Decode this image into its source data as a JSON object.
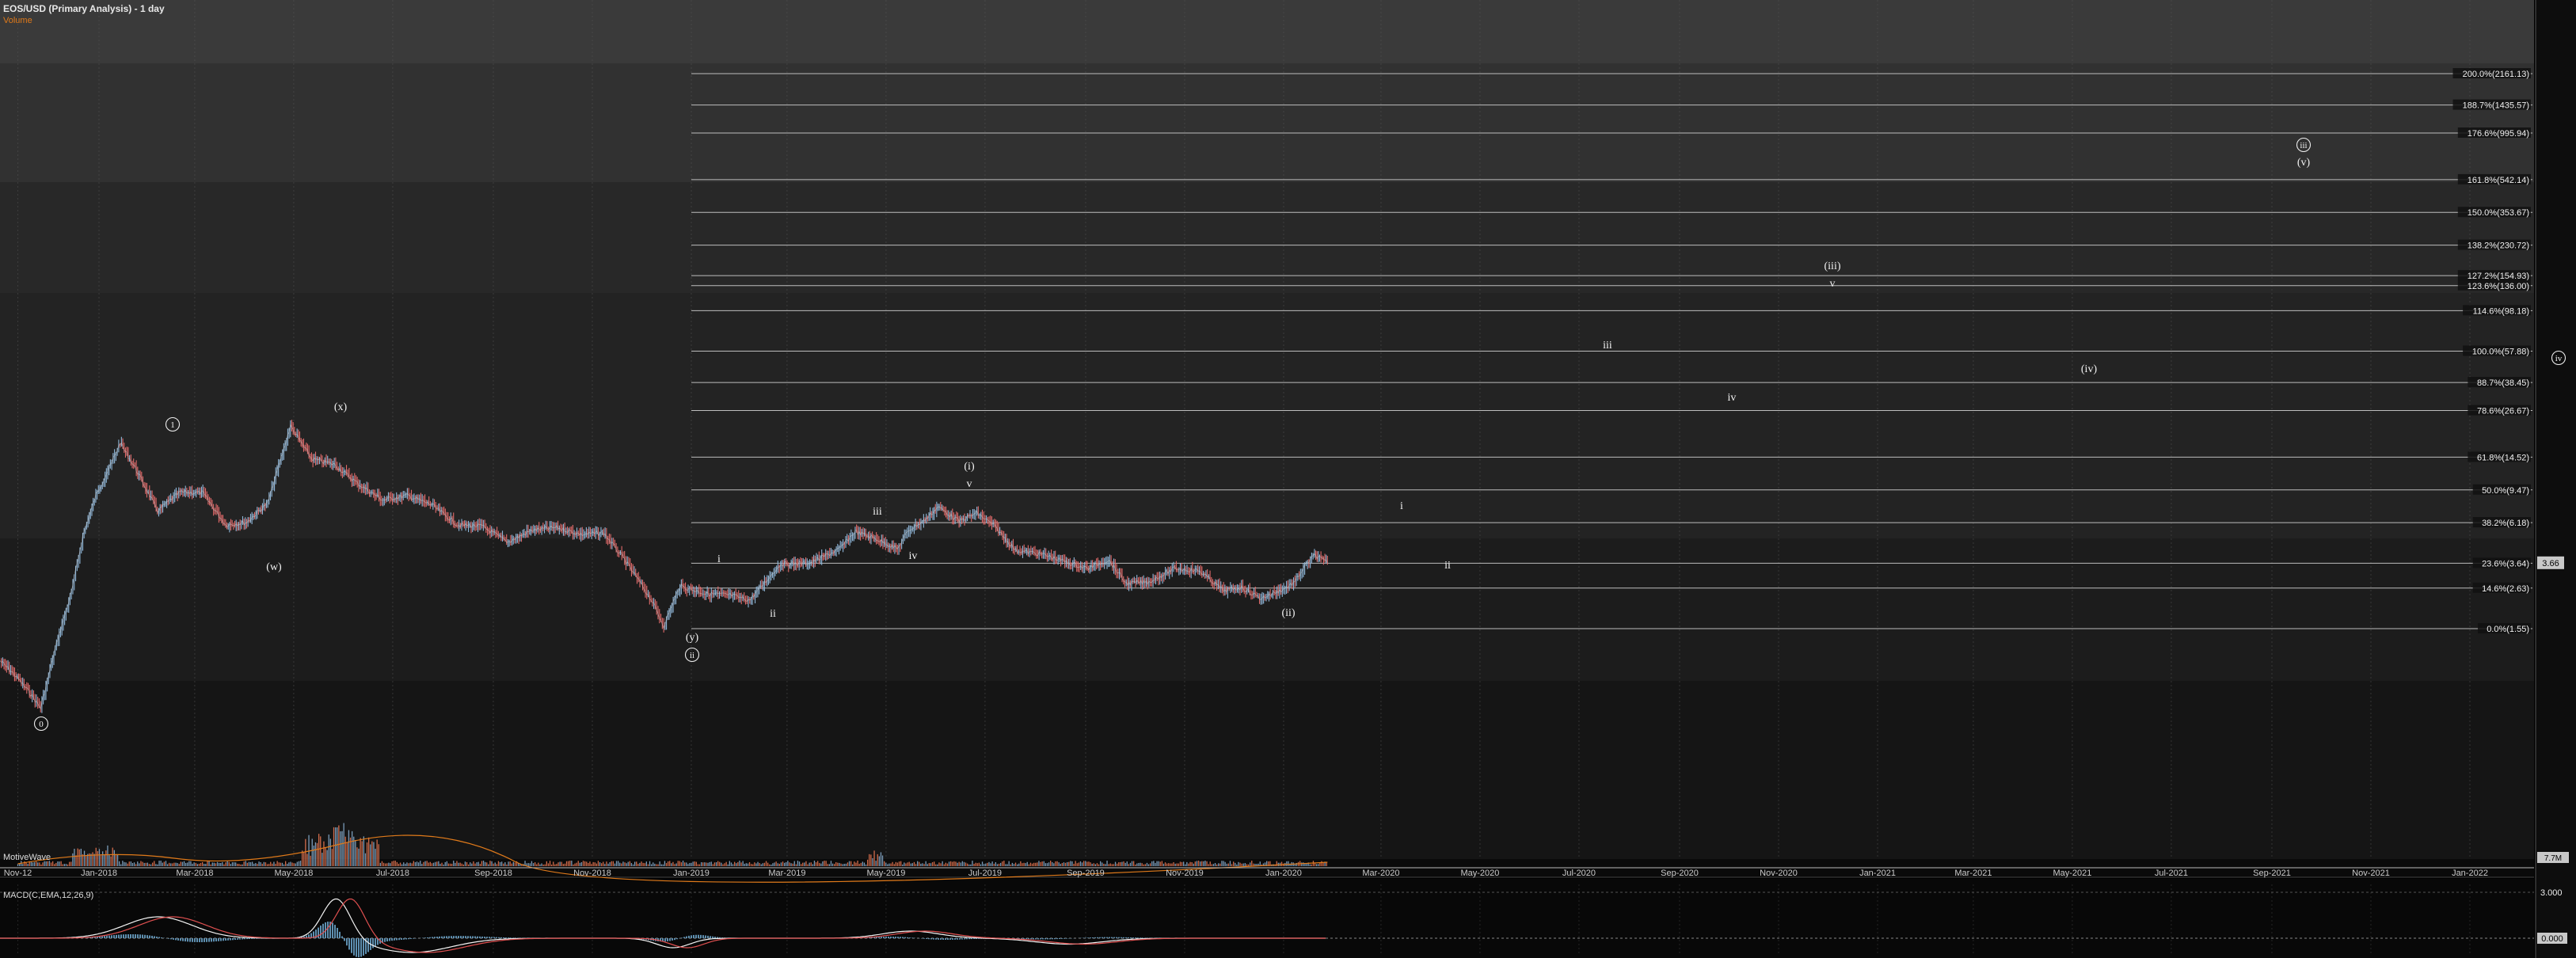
{
  "header": {
    "title": "EOS/USD (Primary Analysis) - 1 day",
    "subtitle": "Volume"
  },
  "brand": "MotiveWave",
  "macd": {
    "label": "MACD(C,EMA,12,26,9)"
  },
  "chart_data": {
    "type": "line",
    "title": "EOS/USD (Primary Analysis) - 1 day",
    "x_ticks": [
      "Nov-12",
      "Jan-2018",
      "Mar-2018",
      "May-2018",
      "Jul-2018",
      "Sep-2018",
      "Nov-2018",
      "Jan-2019",
      "Mar-2019",
      "May-2019",
      "Jul-2019",
      "Sep-2019",
      "Nov-2019",
      "Jan-2020",
      "Mar-2020",
      "May-2020",
      "Jul-2020",
      "Sep-2020",
      "Nov-2020",
      "Jan-2021",
      "Mar-2021",
      "May-2021",
      "Jul-2021",
      "Sep-2021",
      "Nov-2021",
      "Jan-2022"
    ],
    "y_scale": "log",
    "last_price": "3.66",
    "volume_axis_label": "7.7M",
    "macd_axis_labels": [
      "3.000",
      "0.000"
    ],
    "fib_levels": [
      {
        "label": "200.0%(2161.13)",
        "value": 2161.13
      },
      {
        "label": "188.7%(1435.57)",
        "value": 1435.57
      },
      {
        "label": "176.6%(995.94)",
        "value": 995.94
      },
      {
        "label": "161.8%(542.14)",
        "value": 542.14
      },
      {
        "label": "150.0%(353.67)",
        "value": 353.67
      },
      {
        "label": "138.2%(230.72)",
        "value": 230.72
      },
      {
        "label": "127.2%(154.93)",
        "value": 154.93
      },
      {
        "label": "123.6%(136.00)",
        "value": 136.0
      },
      {
        "label": "114.6%(98.18)",
        "value": 98.18
      },
      {
        "label": "100.0%(57.88)",
        "value": 57.88
      },
      {
        "label": "88.7%(38.45)",
        "value": 38.45
      },
      {
        "label": "78.6%(26.67)",
        "value": 26.67
      },
      {
        "label": "61.8%(14.52)",
        "value": 14.52
      },
      {
        "label": "50.0%(9.47)",
        "value": 9.47
      },
      {
        "label": "38.2%(6.18)",
        "value": 6.18
      },
      {
        "label": "23.6%(3.64)",
        "value": 3.64
      },
      {
        "label": "14.6%(2.63)",
        "value": 2.63
      },
      {
        "label": "0.0%(1.55)",
        "value": 1.55
      }
    ],
    "wave_labels": [
      {
        "text": "0",
        "circled": true
      },
      {
        "text": "1",
        "circled": true
      },
      {
        "text": "(w)",
        "circled": false
      },
      {
        "text": "(x)",
        "circled": false
      },
      {
        "text": "(y)",
        "circled": false
      },
      {
        "text": "ii",
        "circled": true
      },
      {
        "text": "i",
        "circled": false
      },
      {
        "text": "ii",
        "circled": false
      },
      {
        "text": "iii",
        "circled": false
      },
      {
        "text": "iv",
        "circled": false
      },
      {
        "text": "(i)",
        "circled": false
      },
      {
        "text": "v",
        "circled": false
      },
      {
        "text": "(ii)",
        "circled": false
      },
      {
        "text": "i",
        "circled": false
      },
      {
        "text": "ii",
        "circled": false
      },
      {
        "text": "iii",
        "circled": false
      },
      {
        "text": "iv",
        "circled": false
      },
      {
        "text": "(iii)",
        "circled": false
      },
      {
        "text": "v",
        "circled": false
      },
      {
        "text": "(iv)",
        "circled": false
      },
      {
        "text": "iii",
        "circled": true
      },
      {
        "text": "(v)",
        "circled": false
      },
      {
        "text": "iv",
        "circled": true
      }
    ],
    "price_path": [
      [
        "2017-11-01",
        1.02
      ],
      [
        "2017-11-10",
        0.85
      ],
      [
        "2017-11-20",
        0.66
      ],
      [
        "2017-11-26",
        0.55
      ],
      [
        "2017-12-05",
        1.2
      ],
      [
        "2017-12-15",
        2.5
      ],
      [
        "2017-12-22",
        5.2
      ],
      [
        "2017-12-30",
        8.8
      ],
      [
        "2018-01-08",
        13.0
      ],
      [
        "2018-01-14",
        17.5
      ],
      [
        "2018-01-24",
        12.3
      ],
      [
        "2018-02-06",
        7.2
      ],
      [
        "2018-02-20",
        9.2
      ],
      [
        "2018-03-06",
        9.1
      ],
      [
        "2018-03-20",
        6.0
      ],
      [
        "2018-04-02",
        6.2
      ],
      [
        "2018-04-15",
        8.0
      ],
      [
        "2018-04-29",
        21.8
      ],
      [
        "2018-05-12",
        14.2
      ],
      [
        "2018-05-26",
        13.2
      ],
      [
        "2018-06-10",
        10.2
      ],
      [
        "2018-06-25",
        8.3
      ],
      [
        "2018-07-10",
        8.8
      ],
      [
        "2018-07-25",
        7.8
      ],
      [
        "2018-08-10",
        6.0
      ],
      [
        "2018-08-25",
        5.9
      ],
      [
        "2018-09-10",
        4.8
      ],
      [
        "2018-09-25",
        5.6
      ],
      [
        "2018-10-10",
        5.8
      ],
      [
        "2018-10-25",
        5.3
      ],
      [
        "2018-11-08",
        5.4
      ],
      [
        "2018-11-20",
        3.9
      ],
      [
        "2018-12-02",
        2.7
      ],
      [
        "2018-12-08",
        2.2
      ],
      [
        "2018-12-15",
        1.6
      ],
      [
        "2018-12-20",
        2.1
      ],
      [
        "2018-12-25",
        2.7
      ],
      [
        "2019-01-10",
        2.45
      ],
      [
        "2019-01-25",
        2.4
      ],
      [
        "2019-02-06",
        2.25
      ],
      [
        "2019-02-25",
        3.6
      ],
      [
        "2019-03-15",
        3.65
      ],
      [
        "2019-04-02",
        4.35
      ],
      [
        "2019-04-12",
        5.5
      ],
      [
        "2019-04-25",
        5.0
      ],
      [
        "2019-05-08",
        4.4
      ],
      [
        "2019-05-15",
        5.6
      ],
      [
        "2019-05-25",
        6.4
      ],
      [
        "2019-06-02",
        7.6
      ],
      [
        "2019-06-15",
        6.3
      ],
      [
        "2019-06-26",
        7.0
      ],
      [
        "2019-07-06",
        6.0
      ],
      [
        "2019-07-20",
        4.3
      ],
      [
        "2019-08-05",
        4.1
      ],
      [
        "2019-08-20",
        3.7
      ],
      [
        "2019-09-02",
        3.4
      ],
      [
        "2019-09-15",
        3.8
      ],
      [
        "2019-09-26",
        2.8
      ],
      [
        "2019-10-10",
        2.85
      ],
      [
        "2019-10-26",
        3.4
      ],
      [
        "2019-11-10",
        3.3
      ],
      [
        "2019-11-25",
        2.55
      ],
      [
        "2019-12-06",
        2.65
      ],
      [
        "2019-12-18",
        2.3
      ],
      [
        "2020-01-01",
        2.6
      ],
      [
        "2020-01-08",
        2.85
      ],
      [
        "2020-01-14",
        3.5
      ],
      [
        "2020-01-20",
        4.05
      ],
      [
        "2020-01-28",
        3.66
      ]
    ]
  }
}
